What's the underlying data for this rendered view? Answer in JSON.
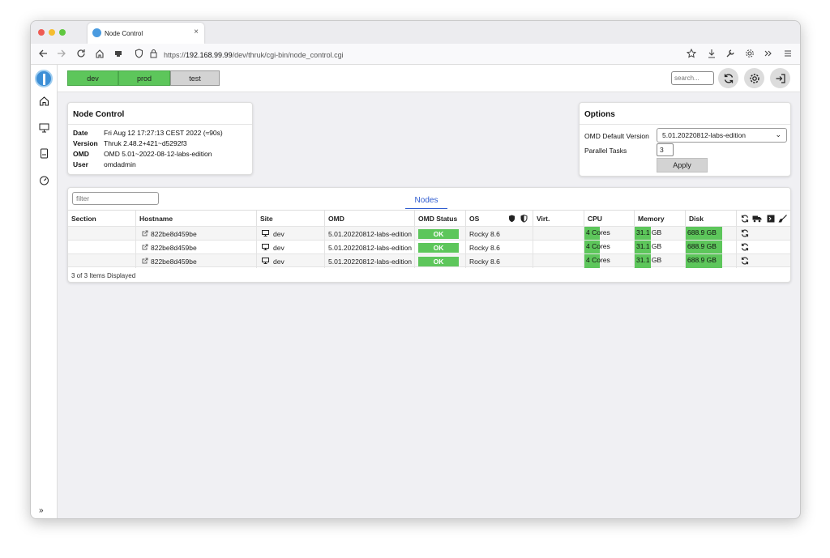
{
  "browser": {
    "tab_title": "Node Control",
    "tab_close": "×",
    "url_prefix": "https://",
    "url_host": "192.168.99.99",
    "url_path": "/dev/thruk/cgi-bin/node_control.cgi"
  },
  "topbar": {
    "sites": [
      {
        "label": "dev",
        "active": true
      },
      {
        "label": "prod",
        "active": true
      },
      {
        "label": "test",
        "active": false
      }
    ],
    "search_placeholder": "search..."
  },
  "node_control": {
    "title": "Node Control",
    "rows": [
      {
        "label": "Date",
        "value": "Fri Aug 12 17:27:13 CEST 2022 (≈90s)"
      },
      {
        "label": "Version",
        "value": "Thruk 2.48.2+421~d5292f3"
      },
      {
        "label": "OMD",
        "value": "OMD 5.01~2022-08-12-labs-edition"
      },
      {
        "label": "User",
        "value": "omdadmin"
      }
    ]
  },
  "options": {
    "title": "Options",
    "default_version_label": "OMD Default Version",
    "default_version_value": "5.01.20220812-labs-edition",
    "parallel_label": "Parallel Tasks",
    "parallel_value": "3",
    "apply_label": "Apply"
  },
  "nodes": {
    "filter_placeholder": "filter",
    "tab_label": "Nodes",
    "columns": [
      "Section",
      "Hostname",
      "Site",
      "OMD",
      "OMD Status",
      "OS",
      "Virt.",
      "CPU",
      "Memory",
      "Disk"
    ],
    "rows": [
      {
        "section": "",
        "hostname": "822be8d459be",
        "site": "dev",
        "omd": "5.01.20220812-labs-edition",
        "status": "OK",
        "os": "Rocky 8.6",
        "virt": "",
        "cpu": "4 Cores",
        "memory": "31.1 GB",
        "disk": "688.9 GB"
      },
      {
        "section": "",
        "hostname": "822be8d459be",
        "site": "dev",
        "omd": "5.01.20220812-labs-edition",
        "status": "OK",
        "os": "Rocky 8.6",
        "virt": "",
        "cpu": "4 Cores",
        "memory": "31.1 GB",
        "disk": "688.9 GB"
      },
      {
        "section": "",
        "hostname": "822be8d459be",
        "site": "dev",
        "omd": "5.01.20220812-labs-edition",
        "status": "OK",
        "os": "Rocky 8.6",
        "virt": "",
        "cpu": "4 Cores",
        "memory": "31.1 GB",
        "disk": "688.9 GB"
      }
    ],
    "footer": "3 of 3 Items Displayed"
  },
  "colors": {
    "ok_green": "#5dc65b",
    "link_blue": "#2f5cd0",
    "site_active": "#5dc65b",
    "site_inactive": "#d3d3d3"
  },
  "sidebar": {
    "expand": "»"
  }
}
